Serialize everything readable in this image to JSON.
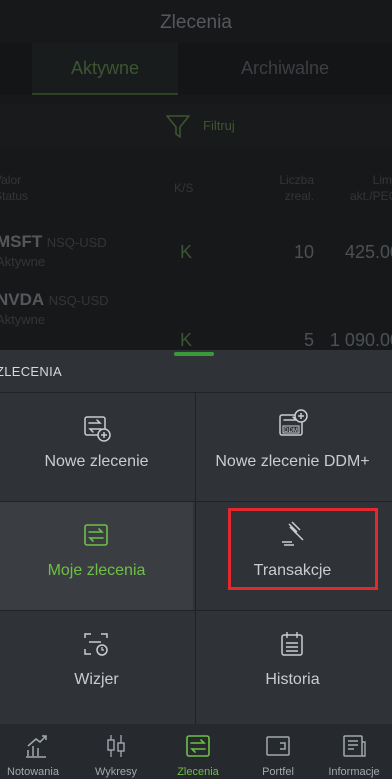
{
  "header": {
    "title": "Zlecenia"
  },
  "tabs": [
    {
      "label": "Aktywne",
      "active": true
    },
    {
      "label": "Archiwalne",
      "active": false
    }
  ],
  "filter": {
    "label": "Filtruj",
    "icon": "filter-icon"
  },
  "table": {
    "headers": {
      "valor": "Valor",
      "status": "Status",
      "ks": "K/S",
      "qty_line1": "Liczba",
      "qty_line2": "zreal.",
      "limit_line1": "Limit",
      "limit_line2": "akt./PEG"
    },
    "rows": [
      {
        "symbol": "MSFT",
        "exchange": "NSQ-USD",
        "status": "Aktywne",
        "ks": "K",
        "qty": "10",
        "limit": "425.00"
      },
      {
        "symbol": "NVDA",
        "exchange": "NSQ-USD",
        "status": "Aktywne",
        "ks": "K",
        "qty": "5",
        "limit": "1 090.00"
      }
    ]
  },
  "sheet": {
    "title": "ZLECENIA",
    "tiles": [
      {
        "label": "Nowe zlecenie",
        "icon": "new-order-icon",
        "selected": false
      },
      {
        "label": "Nowe zlecenie DDM+",
        "icon": "new-ddm-order-icon",
        "selected": false
      },
      {
        "label": "Moje zlecenia",
        "icon": "my-orders-icon",
        "selected": true
      },
      {
        "label": "Transakcje",
        "icon": "transactions-gavel-icon",
        "selected": false
      },
      {
        "label": "Wizjer",
        "icon": "viewfinder-icon",
        "selected": false
      },
      {
        "label": "Historia",
        "icon": "history-calendar-icon",
        "selected": false
      }
    ]
  },
  "nav": [
    {
      "label": "Notowania",
      "icon": "chart-up-icon",
      "active": false
    },
    {
      "label": "Wykresy",
      "icon": "candles-icon",
      "active": false
    },
    {
      "label": "Zlecenia",
      "icon": "orders-icon",
      "active": true
    },
    {
      "label": "Portfel",
      "icon": "wallet-icon",
      "active": false
    },
    {
      "label": "Informacje",
      "icon": "news-icon",
      "active": false
    }
  ],
  "colors": {
    "accent_green": "#6fbf46",
    "highlight_red": "#e3282e",
    "sheet_bg": "#2f3236"
  }
}
